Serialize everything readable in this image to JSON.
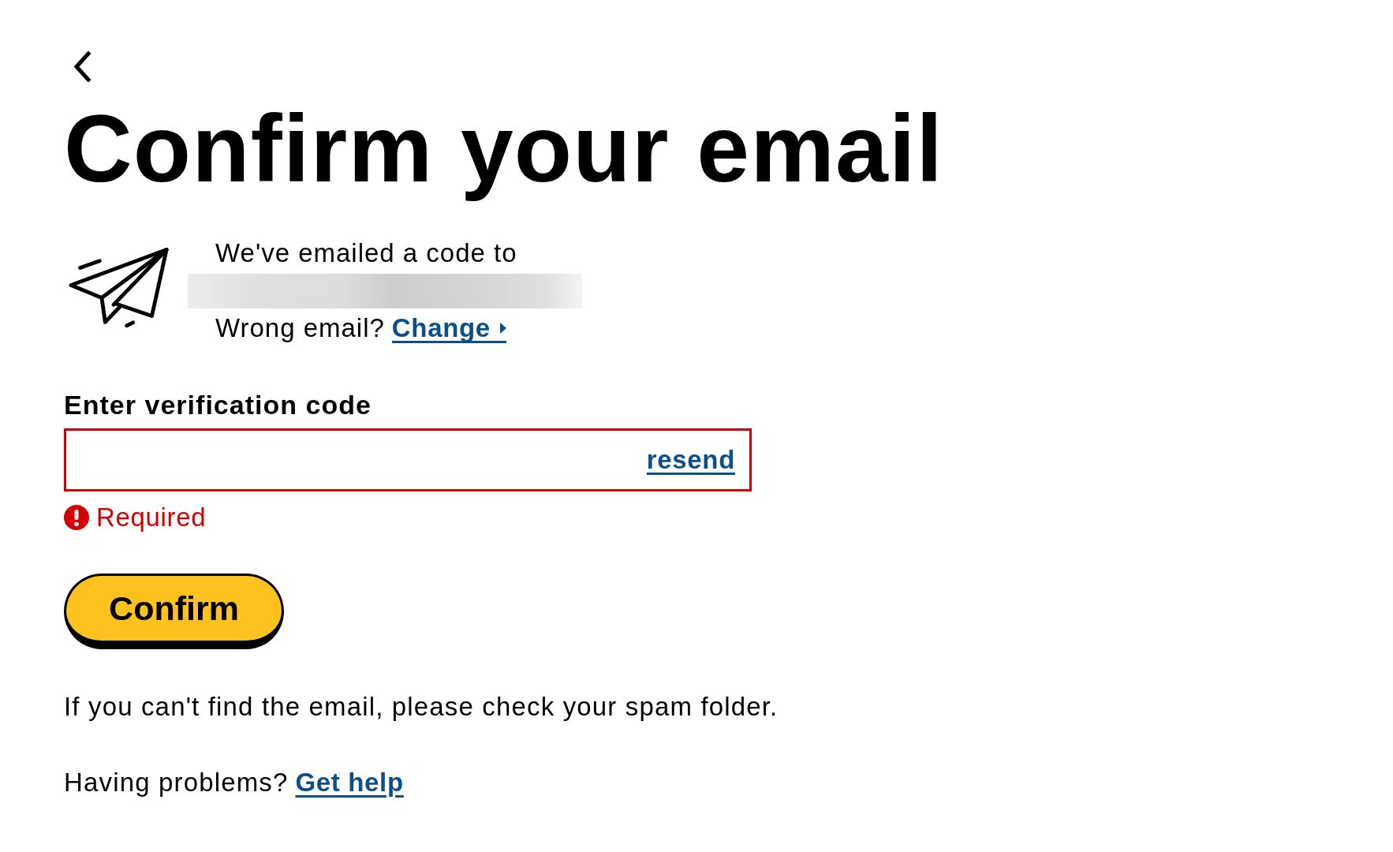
{
  "title": "Confirm your email",
  "sent_notice": {
    "intro": "We've emailed a code to",
    "wrong_email_prompt": "Wrong email?",
    "change_link": "Change"
  },
  "verification": {
    "label": "Enter verification code",
    "resend_link": "resend",
    "invalid": true,
    "error": "Required"
  },
  "confirm_button": "Confirm",
  "spam_hint": "If you can't find the email, please check your spam folder.",
  "help": {
    "prompt": "Having problems?",
    "link": "Get help"
  }
}
